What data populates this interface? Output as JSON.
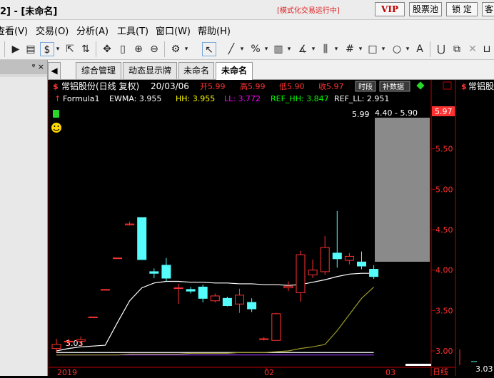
{
  "titlebar": {
    "title": "2] - [未命名]",
    "annotation": "[模式化交易运行中]",
    "buttons": [
      "VIP",
      "股票池",
      "锁 定",
      "客"
    ]
  },
  "menu": [
    "查看(V)",
    "交易(O)",
    "分析(A)",
    "工具(T)",
    "窗口(W)",
    "帮助(H)"
  ],
  "left_panel": {
    "pin": "ᵠ",
    "close": "×"
  },
  "tabs": [
    "综合管理",
    "动态显示牌",
    "未命名",
    "未命名"
  ],
  "chart_header": {
    "stock": "常铝股份(日线 复权)",
    "date": "20/03/06",
    "open": "开5.99",
    "high": "高5.99",
    "low": "低5.90",
    "close": "收5.97",
    "btn_time": "时段",
    "btn_fill": "补数据",
    "right_stock": "常铝股份"
  },
  "formula": {
    "name": "Formula1",
    "ewma": "EWMA: 3.955",
    "hh": "HH: 3.955",
    "ll": "LL: 3.772",
    "ref_hh": "REF_HH: 3.847",
    "ref_ll": "REF_LL: 2.951"
  },
  "annotations": {
    "top_price": "5.99",
    "range": "4.40 - 5.90",
    "low_price": "3.03",
    "current_price_tag": "5.97",
    "right_low": "3.03"
  },
  "colors": {
    "up": "#ff3232",
    "down": "#54fcfc",
    "axis": "#c00000",
    "ewma": "#ffffff",
    "hh": "#ffff00",
    "ll": "#ff00ff",
    "ref_hh": "#00ff00",
    "ref_ll": "#ffffff",
    "olive": "#9a9a2a",
    "purple": "#9c3cff"
  },
  "chart_data": {
    "type": "candlestick",
    "y_ticks": [
      "5.97",
      "5.50",
      "5.00",
      "4.50",
      "4.00",
      "3.50",
      "3.00"
    ],
    "x_labels": [
      "2019",
      "02",
      "03"
    ],
    "period_label": "日线",
    "candles": [
      {
        "o": 3.03,
        "c": 3.08,
        "h": 3.15,
        "l": 2.98
      },
      {
        "o": 3.12,
        "c": 3.12,
        "h": 3.15,
        "l": 3.06
      },
      {
        "o": 3.12,
        "c": 3.14,
        "h": 3.18,
        "l": 3.06
      },
      {
        "o": 3.42,
        "c": 3.42,
        "h": 3.42,
        "l": 3.42
      },
      {
        "o": 3.76,
        "c": 3.76,
        "h": 3.76,
        "l": 3.76
      },
      {
        "o": 4.15,
        "c": 4.15,
        "h": 4.15,
        "l": 4.15
      },
      {
        "o": 4.56,
        "c": 4.57,
        "h": 4.6,
        "l": 4.55
      },
      {
        "o": 4.65,
        "c": 4.13,
        "h": 4.65,
        "l": 4.13
      },
      {
        "o": 3.98,
        "c": 3.96,
        "h": 4.02,
        "l": 3.9
      },
      {
        "o": 4.06,
        "c": 3.9,
        "h": 4.15,
        "l": 3.86
      },
      {
        "o": 3.78,
        "c": 3.78,
        "h": 3.83,
        "l": 3.58
      },
      {
        "o": 3.76,
        "c": 3.74,
        "h": 3.79,
        "l": 3.71
      },
      {
        "o": 3.79,
        "c": 3.65,
        "h": 3.82,
        "l": 3.6
      },
      {
        "o": 3.62,
        "c": 3.68,
        "h": 3.71,
        "l": 3.6
      },
      {
        "o": 3.65,
        "c": 3.56,
        "h": 3.67,
        "l": 3.55
      },
      {
        "o": 3.58,
        "c": 3.69,
        "h": 3.77,
        "l": 3.47
      },
      {
        "o": 3.6,
        "c": 3.52,
        "h": 3.65,
        "l": 3.48
      },
      {
        "o": 3.15,
        "c": 3.15,
        "h": 3.17,
        "l": 3.13
      },
      {
        "o": 3.13,
        "c": 3.46,
        "h": 3.47,
        "l": 3.13
      },
      {
        "o": 3.78,
        "c": 3.8,
        "h": 3.86,
        "l": 3.74
      },
      {
        "o": 3.72,
        "c": 4.19,
        "h": 4.24,
        "l": 3.61
      },
      {
        "o": 3.94,
        "c": 4.0,
        "h": 4.13,
        "l": 3.9
      },
      {
        "o": 3.98,
        "c": 4.28,
        "h": 4.42,
        "l": 3.94
      },
      {
        "o": 4.21,
        "c": 4.14,
        "h": 4.73,
        "l": 4.03
      },
      {
        "o": 4.12,
        "c": 4.17,
        "h": 4.21,
        "l": 4.07
      },
      {
        "o": 4.1,
        "c": 4.05,
        "h": 4.23,
        "l": 4.01
      },
      {
        "o": 4.01,
        "c": 3.92,
        "h": 4.06,
        "l": 3.89
      }
    ],
    "ewma": [
      3.0,
      3.03,
      3.05,
      3.06,
      3.07,
      3.35,
      3.62,
      3.78,
      3.84,
      3.86,
      3.86,
      3.85,
      3.85,
      3.84,
      3.84,
      3.83,
      3.83,
      3.82,
      3.82,
      3.81,
      3.82,
      3.85,
      3.88,
      3.92,
      3.95,
      3.96,
      3.96
    ],
    "ref_hh": [
      2.95,
      2.95,
      2.95,
      2.95,
      2.95,
      2.95,
      2.96,
      2.96,
      2.96,
      2.96,
      2.96,
      2.97,
      2.97,
      2.97,
      2.97,
      2.98,
      2.98,
      2.98,
      2.99,
      3.0,
      3.03,
      3.05,
      3.08,
      3.25,
      3.45,
      3.65,
      3.79
    ],
    "ll": [
      2.95,
      2.95,
      2.95,
      2.95,
      2.95,
      2.95,
      2.95,
      2.95,
      2.95,
      2.95,
      2.95,
      2.95,
      2.95,
      2.95,
      2.95,
      2.95,
      2.95,
      2.95,
      2.95,
      2.95,
      2.95,
      2.95,
      2.95,
      2.95,
      2.95,
      2.95,
      2.95
    ],
    "ref_ll": [
      2.98,
      2.98,
      2.98,
      2.98,
      2.98,
      2.98,
      2.98,
      2.98,
      2.98,
      2.98,
      2.98,
      2.98,
      2.98,
      2.98,
      2.98,
      2.98,
      2.98,
      2.98,
      2.98,
      2.98,
      2.98,
      2.98,
      2.98,
      2.98,
      2.98,
      2.98,
      2.98
    ]
  }
}
